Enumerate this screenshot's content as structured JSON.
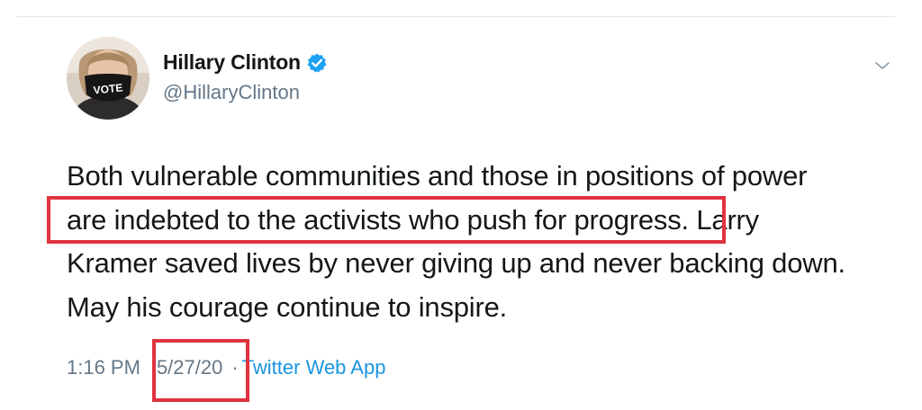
{
  "author": {
    "name": "Hillary Clinton",
    "handle": "@HillaryClinton",
    "verified": true,
    "avatar_mask_text": "VOTE"
  },
  "tweet": {
    "line1": "Both vulnerable communities and those in positions of power",
    "line2_highlighted": "are indebted to the activists who push for progress",
    "line2_rest": ". Larry",
    "line3": "Kramer saved lives by never giving up and never backing down.",
    "line4": "May his courage continue to inspire."
  },
  "meta": {
    "time": "1:16 PM",
    "separator": "·",
    "date": "5/27/20",
    "source": "Twitter Web App"
  },
  "colors": {
    "highlight_box": "#e0333f",
    "link": "#1b95e0",
    "verified_badge": "#1da1f2",
    "secondary_text": "#657786"
  },
  "icons": {
    "verified": "verified-badge-icon",
    "menu": "chevron-down-icon"
  }
}
